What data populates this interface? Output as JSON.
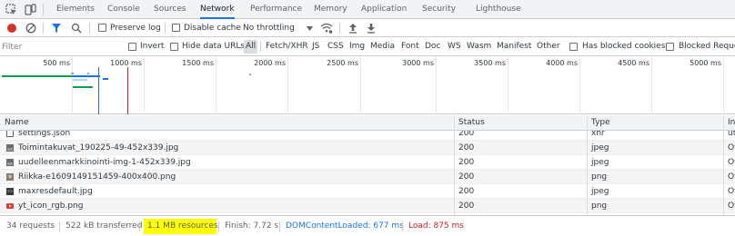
{
  "tabbar": {
    "tabs": [
      {
        "label": "Elements"
      },
      {
        "label": "Console"
      },
      {
        "label": "Sources"
      },
      {
        "label": "Network"
      },
      {
        "label": "Performance"
      },
      {
        "label": "Memory"
      },
      {
        "label": "Application"
      },
      {
        "label": "Security"
      },
      {
        "label": "Lighthouse"
      }
    ],
    "active_tab": "Network"
  },
  "toolbar": {
    "preserve_log": "Preserve log",
    "disable_cache": "Disable cache",
    "throttling": "No throttling"
  },
  "filterbar": {
    "placeholder": "Filter",
    "invert": "Invert",
    "hide_data_urls": "Hide data URLs",
    "types": [
      "All",
      "Fetch/XHR",
      "JS",
      "CSS",
      "Img",
      "Media",
      "Font",
      "Doc",
      "WS",
      "Wasm",
      "Manifest",
      "Other"
    ],
    "blocked_cookies": "Has blocked cookies",
    "blocked_requests": "Blocked Reque"
  },
  "overview": {
    "ticks": [
      "500 ms",
      "1000 ms",
      "1500 ms",
      "2000 ms",
      "2500 ms",
      "3000 ms",
      "3500 ms",
      "4000 ms",
      "4500 ms",
      "5000 ms"
    ]
  },
  "table": {
    "headers": {
      "name": "Name",
      "status": "Status",
      "type": "Type",
      "initiator": "Ini"
    },
    "rows": [
      {
        "name": "settings.json",
        "status": "200",
        "type": "xhr",
        "initiator": "ut",
        "icon": "file-icon"
      },
      {
        "name": "Toimintakuvat_190225-49-452x339.jpg",
        "status": "200",
        "type": "jpeg",
        "initiator": "Ot",
        "icon": "image-icon"
      },
      {
        "name": "uudelleenmarkkinointi-img-1-452x339.jpg",
        "status": "200",
        "type": "jpeg",
        "initiator": "Ot",
        "icon": "image-icon"
      },
      {
        "name": "Riikka-e1609149151459-400x400.png",
        "status": "200",
        "type": "png",
        "initiator": "Ot",
        "icon": "image-icon"
      },
      {
        "name": "maxresdefault.jpg",
        "status": "200",
        "type": "jpeg",
        "initiator": "Ot",
        "icon": "image-icon"
      },
      {
        "name": "yt_icon_rgb.png",
        "status": "200",
        "type": "png",
        "initiator": "Ot",
        "icon": "red-image-icon"
      }
    ]
  },
  "statusbar": {
    "requests": "34 requests",
    "transferred": "522 kB transferred",
    "resources": "1.1 MB resources",
    "finish": "Finish: 7.72 s",
    "domcontentloaded": "DOMContentLoaded: 677 ms",
    "load": "Load: 875 ms"
  },
  "colors": {
    "accent": "#1a73e8",
    "record": "#d93025",
    "dcl": "#1a73e8",
    "load": "#c5221f",
    "highlight": "#ffff00"
  }
}
